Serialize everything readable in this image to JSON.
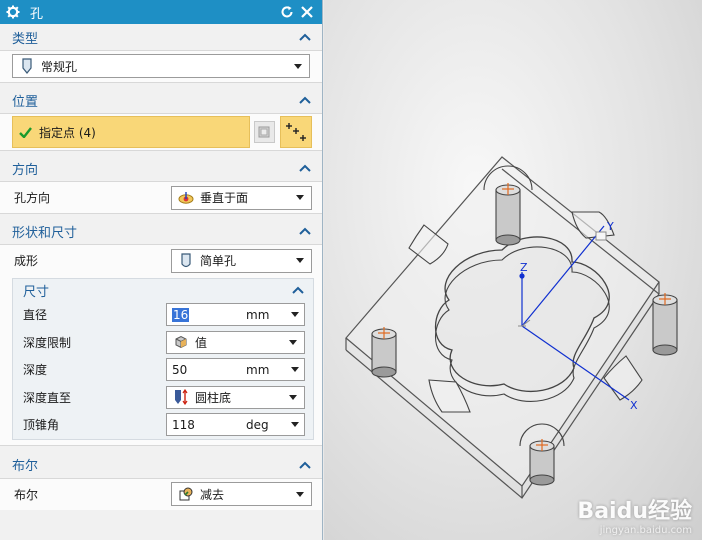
{
  "dialog": {
    "title": "孔"
  },
  "type_section": {
    "header": "类型",
    "value": "常规孔"
  },
  "position_section": {
    "header": "位置",
    "specify_point": "指定点 (4)"
  },
  "direction_section": {
    "header": "方向",
    "label": "孔方向",
    "value": "垂直于面"
  },
  "shape_section": {
    "header": "形状和尺寸",
    "form_label": "成形",
    "form_value": "简单孔",
    "dimensions": {
      "header": "尺寸",
      "diameter_label": "直径",
      "diameter_value": "16",
      "diameter_unit": "mm",
      "depth_limit_label": "深度限制",
      "depth_limit_value": "值",
      "depth_label": "深度",
      "depth_value": "50",
      "depth_unit": "mm",
      "depth_to_label": "深度直至",
      "depth_to_value": "圆柱底",
      "tip_angle_label": "顶锥角",
      "tip_angle_value": "118",
      "tip_angle_unit": "deg"
    }
  },
  "boolean_section": {
    "header": "布尔",
    "label": "布尔",
    "value": "减去"
  },
  "viewport": {
    "axis_x": "X",
    "axis_y": "Y",
    "axis_z": "Z",
    "watermark_main": "Baidu经验",
    "watermark_sub": "jingyan.baidu.com"
  },
  "colors": {
    "titlebar": "#1e8fc5",
    "section_header_text": "#1f5f9a",
    "selected_highlight": "#f9d778",
    "axis_blue": "#1030d0"
  }
}
